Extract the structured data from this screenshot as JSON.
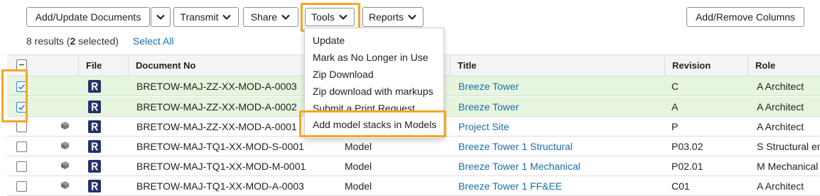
{
  "toolbar": {
    "add_update": "Add/Update Documents",
    "transmit": "Transmit",
    "share": "Share",
    "tools": "Tools",
    "reports": "Reports",
    "add_remove_columns": "Add/Remove Columns"
  },
  "results": {
    "count_prefix": "8 results (",
    "selected_count": "2",
    "selected_suffix": " selected)",
    "select_all": "Select All"
  },
  "table": {
    "headers": {
      "file": "File",
      "document_no": "Document No",
      "title": "Title",
      "revision": "Revision",
      "role": "Role"
    },
    "rows": [
      {
        "doc": "BRETOW-MAJ-ZZ-XX-MOD-A-0003",
        "type": "",
        "title": "Breeze Tower",
        "rev": "C",
        "role": "A Architect",
        "selected": true,
        "model_icon": false
      },
      {
        "doc": "BRETOW-MAJ-ZZ-XX-MOD-A-0002",
        "type": "",
        "title": "Breeze Tower",
        "rev": "A",
        "role": "A Architect",
        "selected": true,
        "model_icon": false
      },
      {
        "doc": "BRETOW-MAJ-ZZ-XX-MOD-A-0001",
        "type": "",
        "title": "Project Site",
        "rev": "P",
        "role": "A Architect",
        "selected": false,
        "model_icon": true
      },
      {
        "doc": "BRETOW-MAJ-TQ1-XX-MOD-S-0001",
        "type": "Model",
        "title": "Breeze Tower 1 Structural",
        "rev": "P03.02",
        "role": "S Structural en",
        "selected": false,
        "model_icon": true
      },
      {
        "doc": "BRETOW-MAJ-TQ1-XX-MOD-M-0001",
        "type": "Model",
        "title": "Breeze Tower 1 Mechanical",
        "rev": "P02.01",
        "role": "M Mechanical",
        "selected": false,
        "model_icon": true
      },
      {
        "doc": "BRETOW-MAJ-TQ1-XX-MOD-A-0003",
        "type": "Model",
        "title": "Breeze Tower 1 FF&EE",
        "rev": "C01",
        "role": "A Architect",
        "selected": false,
        "model_icon": true
      }
    ]
  },
  "tools_menu": {
    "items": [
      "Update",
      "Mark as No Longer in Use",
      "Zip Download",
      "Zip download with markups",
      "Submit a Print Request",
      "Add model stacks in Models"
    ]
  },
  "colors": {
    "highlight": "#f5a623",
    "link": "#1a6fa8",
    "selected_row": "#e6f5de",
    "checkbox": "#2a7fd4",
    "file_icon_bg": "#25316b"
  },
  "icons": {
    "dropdown": "chevron-down-icon",
    "checkbox": "checkbox-icon",
    "model": "cube-icon",
    "file": "revit-file-icon"
  }
}
